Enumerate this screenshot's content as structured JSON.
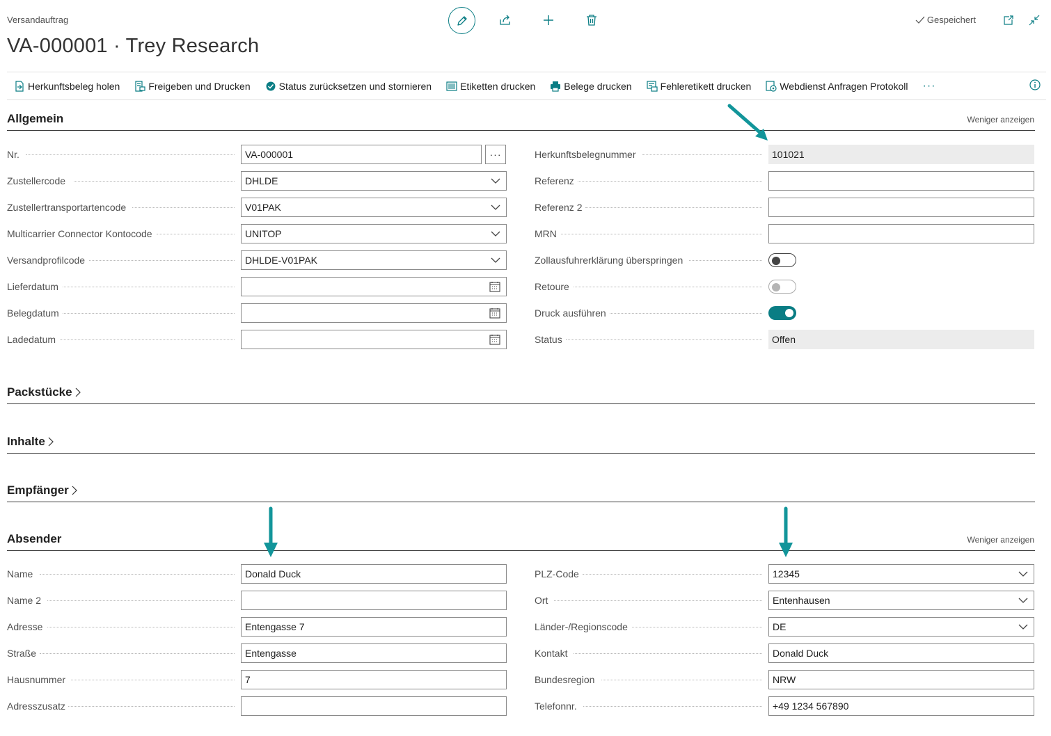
{
  "header": {
    "caption": "Versandauftrag",
    "title": "VA-000001 · Trey Research",
    "saved_label": "Gespeichert"
  },
  "actions": [
    {
      "label": "Herkunftsbeleg holen",
      "icon": "get-document-icon"
    },
    {
      "label": "Freigeben und Drucken",
      "icon": "release-print-icon"
    },
    {
      "label": "Status zurücksetzen und stornieren",
      "icon": "reset-status-icon"
    },
    {
      "label": "Etiketten drucken",
      "icon": "barcode-icon"
    },
    {
      "label": "Belege drucken",
      "icon": "printer-icon"
    },
    {
      "label": "Fehleretikett drucken",
      "icon": "error-label-icon"
    },
    {
      "label": "Webdienst Anfragen Protokoll",
      "icon": "webservice-log-icon"
    }
  ],
  "more_label": "···",
  "sections": {
    "allgemein": {
      "title": "Allgemein",
      "less_label": "Weniger anzeigen"
    },
    "packstuecke": {
      "title": "Packstücke"
    },
    "inhalte": {
      "title": "Inhalte"
    },
    "empfaenger": {
      "title": "Empfänger"
    },
    "absender": {
      "title": "Absender",
      "less_label": "Weniger anzeigen"
    }
  },
  "allgemein_left": [
    {
      "label": "Nr.",
      "value": "VA-000001",
      "kind": "lookup"
    },
    {
      "label": "Zustellercode",
      "value": "DHLDE",
      "kind": "dropdown"
    },
    {
      "label": "Zustellertransportartencode",
      "value": "V01PAK",
      "kind": "dropdown"
    },
    {
      "label": "Multicarrier Connector Kontocode",
      "value": "UNITOP",
      "kind": "dropdown"
    },
    {
      "label": "Versandprofilcode",
      "value": "DHLDE-V01PAK",
      "kind": "dropdown"
    },
    {
      "label": "Lieferdatum",
      "value": "",
      "kind": "date"
    },
    {
      "label": "Belegdatum",
      "value": "",
      "kind": "date"
    },
    {
      "label": "Ladedatum",
      "value": "",
      "kind": "date"
    }
  ],
  "allgemein_right": {
    "herkunft": {
      "label": "Herkunftsbelegnummer",
      "value": "101021"
    },
    "referenz": {
      "label": "Referenz",
      "value": ""
    },
    "referenz2": {
      "label": "Referenz 2",
      "value": ""
    },
    "mrn": {
      "label": "MRN",
      "value": ""
    },
    "zoll": {
      "label": "Zollausfuhrerklärung überspringen",
      "on": false
    },
    "retoure": {
      "label": "Retoure",
      "on": false,
      "disabled": true
    },
    "druck": {
      "label": "Druck ausführen",
      "on": true
    },
    "status": {
      "label": "Status",
      "value": "Offen"
    }
  },
  "absender_left": [
    {
      "label": "Name",
      "value": "Donald Duck"
    },
    {
      "label": "Name 2",
      "value": ""
    },
    {
      "label": "Adresse",
      "value": "Entengasse 7"
    },
    {
      "label": "Straße",
      "value": "Entengasse"
    },
    {
      "label": "Hausnummer",
      "value": "7"
    },
    {
      "label": "Adresszusatz",
      "value": ""
    }
  ],
  "absender_right": [
    {
      "label": "PLZ-Code",
      "value": "12345",
      "kind": "dropdown"
    },
    {
      "label": "Ort",
      "value": "Entenhausen",
      "kind": "dropdown"
    },
    {
      "label": "Länder-/Regionscode",
      "value": "DE",
      "kind": "dropdown"
    },
    {
      "label": "Kontakt",
      "value": "Donald Duck",
      "kind": "text"
    },
    {
      "label": "Bundesregion",
      "value": "NRW",
      "kind": "text"
    },
    {
      "label": "Telefonnr.",
      "value": "+49 1234 567890",
      "kind": "text"
    }
  ],
  "colors": {
    "accent": "#0a7d84",
    "readonly_bg": "#ececec",
    "annotation_arrow": "#12959a"
  }
}
